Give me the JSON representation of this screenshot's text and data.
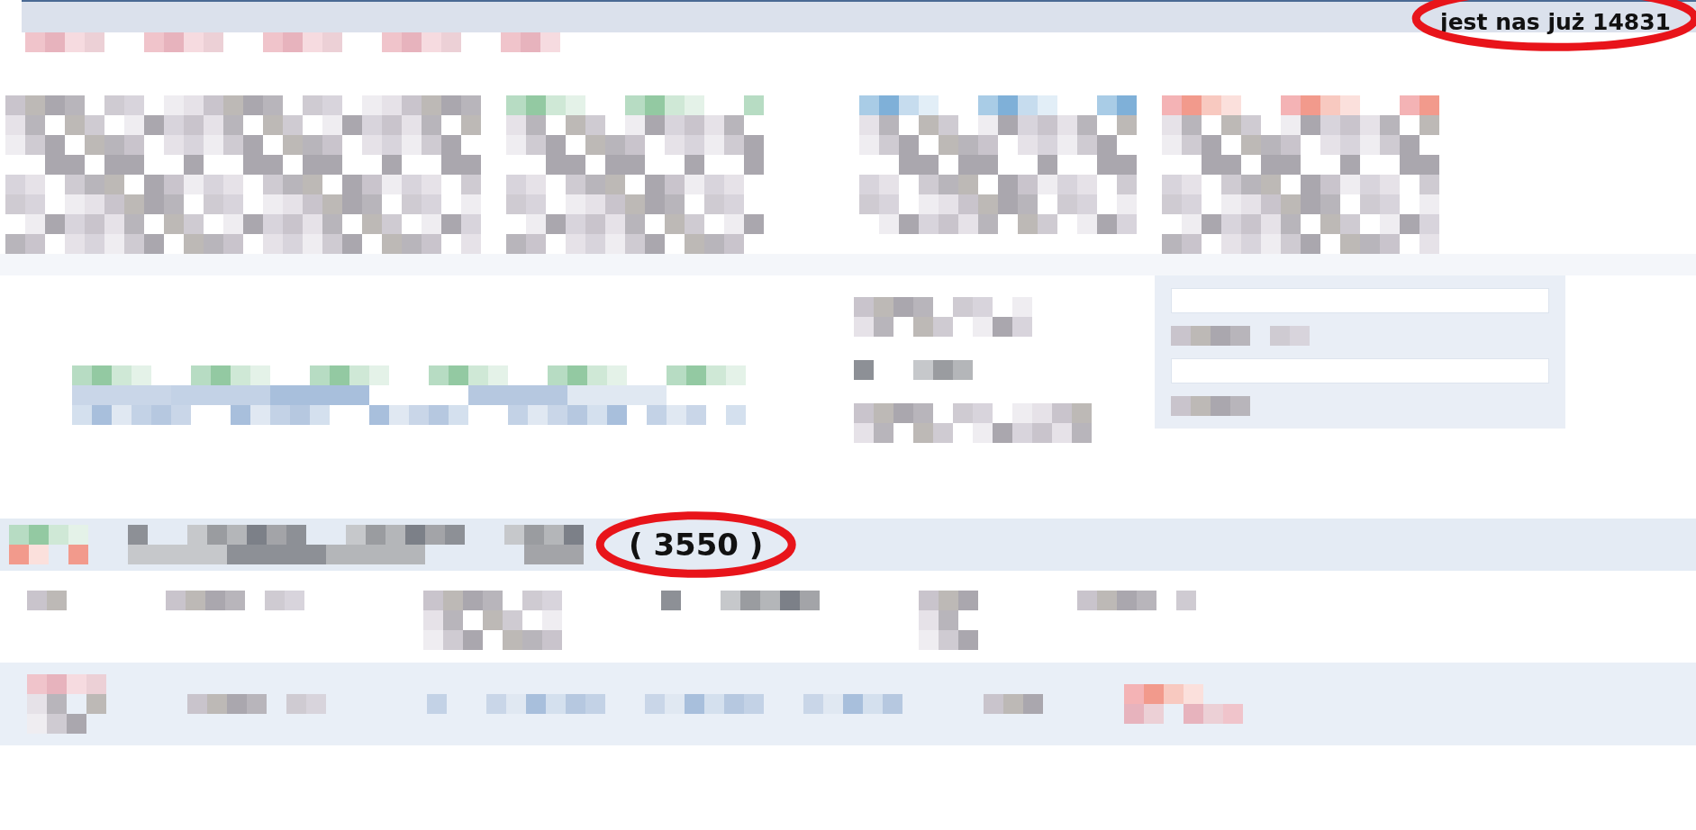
{
  "header": {
    "member_count": {
      "text": "jest nas już 14831",
      "highlighted": true
    }
  },
  "list_bar": {
    "count": {
      "text": "( 3550 )",
      "highlighted": true
    }
  }
}
